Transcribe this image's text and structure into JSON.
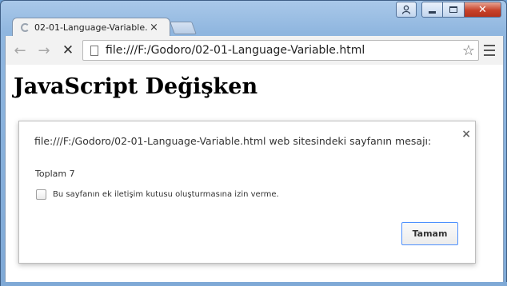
{
  "window": {
    "tab_title": "02-01-Language-Variable.",
    "tab_close": "×",
    "address_url": "file:///F:/Godoro/02-01-Language-Variable.html"
  },
  "toolbar": {
    "back_glyph": "←",
    "forward_glyph": "→",
    "stop_glyph": "✕",
    "star_glyph": "☆"
  },
  "page": {
    "heading": "JavaScript Değişken"
  },
  "dialog": {
    "message": "file:///F:/Godoro/02-01-Language-Variable.html web sitesindeki sayfanın mesajı:",
    "close_glyph": "×",
    "body": "Toplam 7",
    "suppress_label": "Bu sayfanın ek iletişim kutusu oluşturmasına izin verme.",
    "suppress_checked": false,
    "ok_label": "Tamam"
  },
  "icons": {
    "user": "user-icon",
    "minimize": "minimize-icon",
    "maximize": "maximize-icon",
    "close": "close-icon",
    "page": "page-icon",
    "bookmark": "star-icon",
    "menu": "hamburger-menu-icon",
    "loading": "spinner-icon"
  },
  "colors": {
    "accent_button_border": "#4d90fe",
    "window_close_red": "#c7422a"
  }
}
